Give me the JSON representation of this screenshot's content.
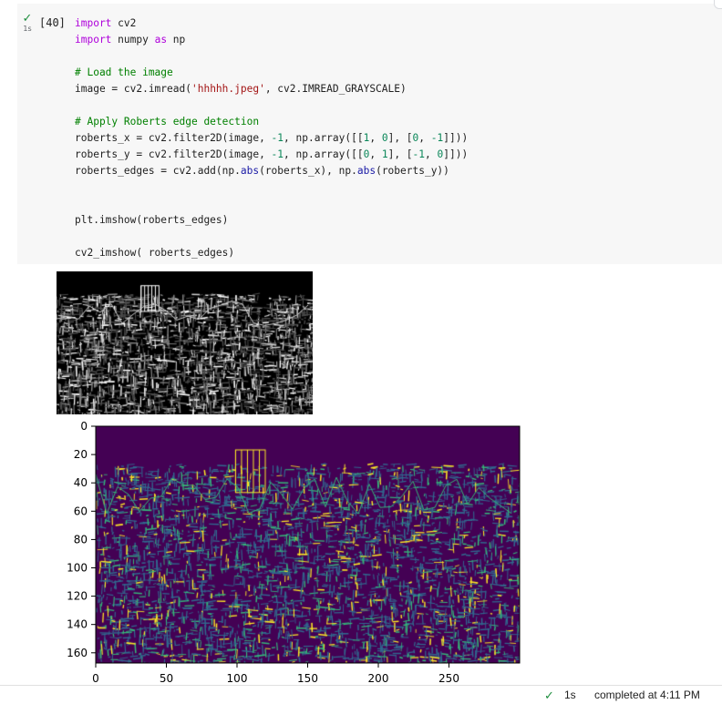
{
  "cell": {
    "status": "✓",
    "run_time": "1s",
    "execution_count": "[40]",
    "code_lines": [
      [
        {
          "t": "import",
          "c": "kw"
        },
        {
          "t": " cv2"
        }
      ],
      [
        {
          "t": "import",
          "c": "kw"
        },
        {
          "t": " numpy "
        },
        {
          "t": "as",
          "c": "kw"
        },
        {
          "t": " np"
        }
      ],
      [],
      [
        {
          "t": "# Load the image",
          "c": "cm"
        }
      ],
      [
        {
          "t": "image = cv2.imread("
        },
        {
          "t": "'hhhhh.jpeg'",
          "c": "st"
        },
        {
          "t": ", cv2.IMREAD_GRAYSCALE)"
        }
      ],
      [],
      [
        {
          "t": "# Apply Roberts edge detection",
          "c": "cm"
        }
      ],
      [
        {
          "t": "roberts_x = cv2.filter2D(image, "
        },
        {
          "t": "-1",
          "c": "nm"
        },
        {
          "t": ", np.array([["
        },
        {
          "t": "1",
          "c": "nm"
        },
        {
          "t": ", "
        },
        {
          "t": "0",
          "c": "nm"
        },
        {
          "t": "], ["
        },
        {
          "t": "0",
          "c": "nm"
        },
        {
          "t": ", "
        },
        {
          "t": "-1",
          "c": "nm"
        },
        {
          "t": "]]))"
        }
      ],
      [
        {
          "t": "roberts_y = cv2.filter2D(image, "
        },
        {
          "t": "-1",
          "c": "nm"
        },
        {
          "t": ", np.array([["
        },
        {
          "t": "0",
          "c": "nm"
        },
        {
          "t": ", "
        },
        {
          "t": "1",
          "c": "nm"
        },
        {
          "t": "], ["
        },
        {
          "t": "-1",
          "c": "nm"
        },
        {
          "t": ", "
        },
        {
          "t": "0",
          "c": "nm"
        },
        {
          "t": "]]))"
        }
      ],
      [
        {
          "t": "roberts_edges = cv2.add(np."
        },
        {
          "t": "abs",
          "c": "pr"
        },
        {
          "t": "(roberts_x), np."
        },
        {
          "t": "abs",
          "c": "pr"
        },
        {
          "t": "(roberts_y))"
        }
      ],
      [],
      [],
      [
        {
          "t": "plt.imshow(roberts_edges)"
        }
      ],
      [],
      [
        {
          "t": "cv2_imshow( roberts_edges)"
        }
      ]
    ]
  },
  "outputs": {
    "plot": {
      "y_ticks": [
        "0",
        "20",
        "40",
        "60",
        "80",
        "100",
        "120",
        "140",
        "160"
      ],
      "x_ticks": [
        "0",
        "50",
        "100",
        "150",
        "200",
        "250"
      ],
      "colormap": [
        "#440154",
        "#31688e",
        "#35b779",
        "#fde725"
      ]
    }
  },
  "status_bar": {
    "check": "✓",
    "duration": "1s",
    "text": "completed at 4:11 PM"
  }
}
